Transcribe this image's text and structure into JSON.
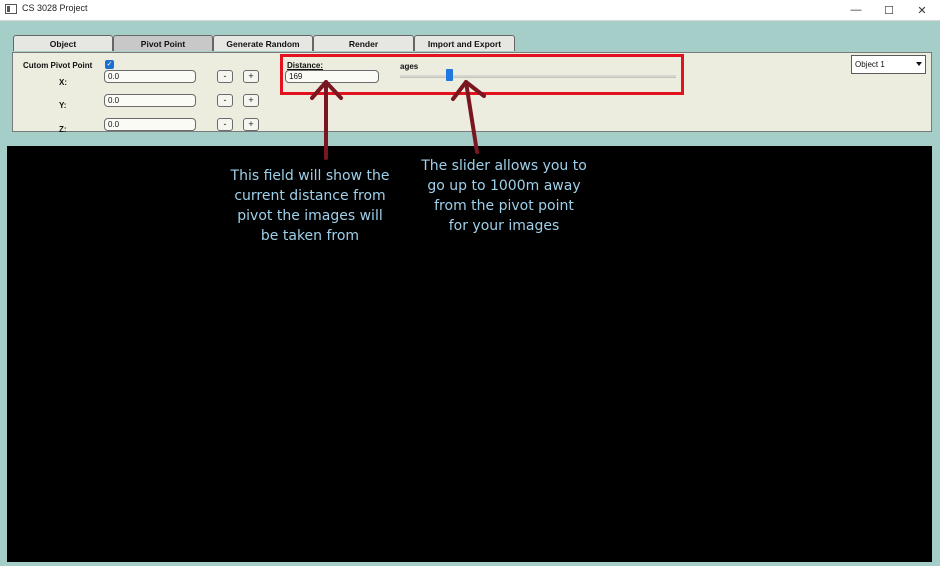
{
  "window": {
    "title": "CS 3028 Project",
    "minimize_glyph": "—",
    "maximize_glyph": "☐",
    "close_glyph": "✕"
  },
  "tabs": [
    {
      "label": "Object"
    },
    {
      "label": "Pivot Point",
      "active": true
    },
    {
      "label": "Generate Random"
    },
    {
      "label": "Render"
    },
    {
      "label": "Import and Export"
    }
  ],
  "pivot_panel": {
    "custom_label": "Cutom Pivot Point",
    "custom_checked": true,
    "x_label": "X:",
    "y_label": "Y:",
    "z_label": "Z:",
    "x_value": "0.0",
    "y_value": "0.0",
    "z_value": "0.0",
    "minus": "-",
    "plus": "+"
  },
  "distance": {
    "label": "Distance:",
    "value": "169",
    "slider_label_partial": "ages",
    "slider_fraction": 0.169
  },
  "object_select": {
    "selected": "Object 1"
  },
  "annotations": {
    "field_note": [
      "This field will show the",
      "current distance from",
      "pivot the images will",
      "be taken from"
    ],
    "slider_note": [
      "The slider allows you to",
      "go up to 1000m away",
      "from the pivot point",
      "for your images"
    ]
  },
  "colors": {
    "highlight": "#e2121e",
    "arrow": "#7a1620",
    "note_text": "#9fd0ea",
    "slider_handle": "#1e78e0"
  }
}
